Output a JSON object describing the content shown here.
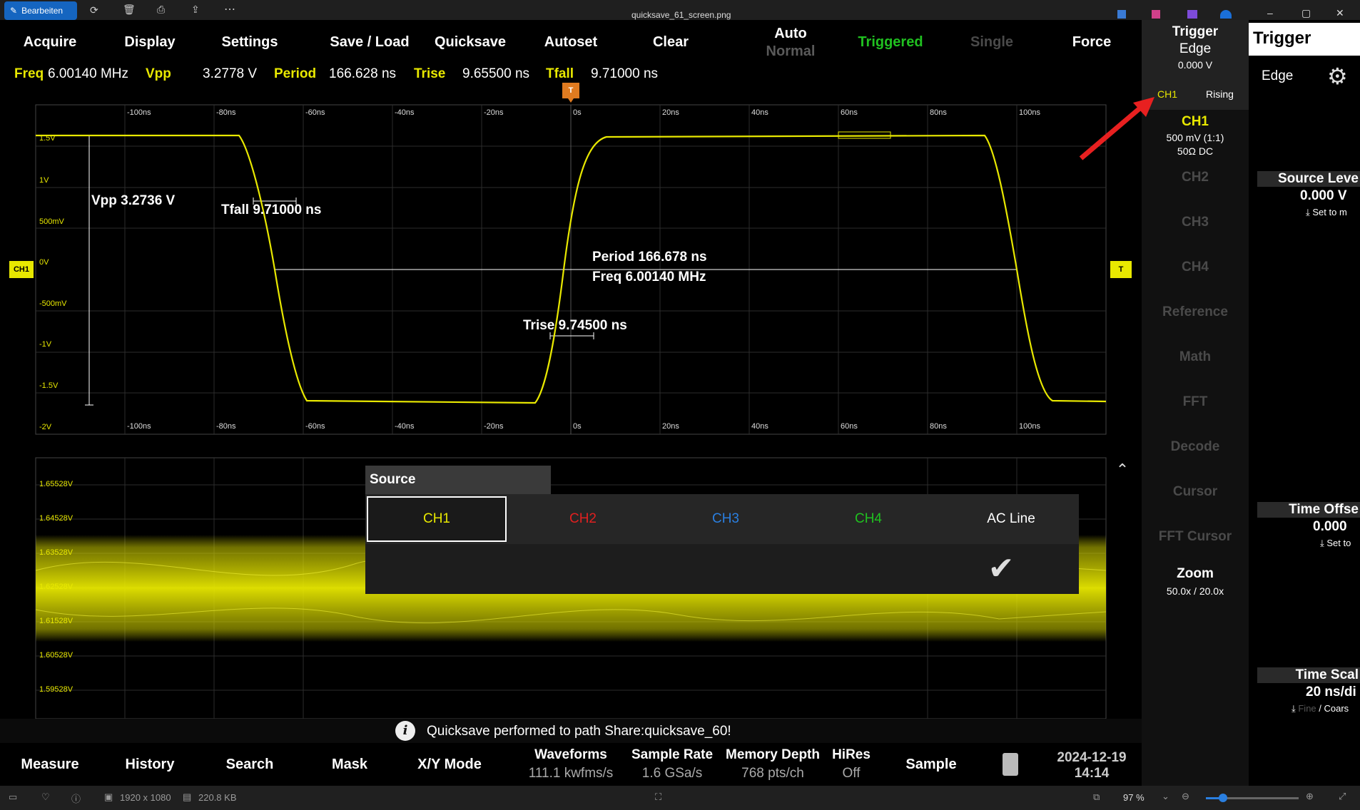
{
  "viewer": {
    "edit_label": "Bearbeiten",
    "filename": "quicksave_61_screen.png",
    "dimensions": "1920 x 1080",
    "filesize": "220.8 KB",
    "zoom": "97 %"
  },
  "menu": {
    "acquire": "Acquire",
    "display": "Display",
    "settings": "Settings",
    "save_load": "Save / Load",
    "quicksave": "Quicksave",
    "autoset": "Autoset",
    "clear": "Clear",
    "auto": "Auto",
    "normal": "Normal",
    "triggered": "Triggered",
    "single": "Single",
    "force": "Force"
  },
  "measurements": {
    "freq_label": "Freq",
    "freq_value": "6.00140 MHz",
    "vpp_label": "Vpp",
    "vpp_value": "3.2778 V",
    "period_label": "Period",
    "period_value": "166.628 ns",
    "trise_label": "Trise",
    "trise_value": "9.65500 ns",
    "tfall_label": "Tfall",
    "tfall_value": "9.71000 ns"
  },
  "scope": {
    "x_ticks": [
      "-100ns",
      "-80ns",
      "-60ns",
      "-40ns",
      "-20ns",
      "0s",
      "20ns",
      "40ns",
      "60ns",
      "80ns",
      "100ns"
    ],
    "y_ticks": [
      "1.5V",
      "1V",
      "500mV",
      "0V",
      "-500mV",
      "-1V",
      "-1.5V",
      "-2V"
    ],
    "ch1_marker": "CH1",
    "trigger_marker": "T",
    "vpp_annot": "Vpp 3.2736 V",
    "tfall_annot": "Tfall 9.71000 ns",
    "period_annot": "Period 166.678 ns",
    "freq_annot": "Freq 6.00140 MHz",
    "trise_annot": "Trise 9.74500 ns"
  },
  "zoom_view": {
    "y_ticks": [
      "1.65528V",
      "1.64528V",
      "1.63528V",
      "1.62528V",
      "1.61528V",
      "1.60528V",
      "1.59528V"
    ]
  },
  "source_popup": {
    "title": "Source",
    "options": [
      "CH1",
      "CH2",
      "CH3",
      "CH4",
      "AC Line"
    ],
    "selected": "CH1",
    "option_colors": [
      "#e8e800",
      "#e02020",
      "#2a7fe0",
      "#20c020",
      "#ffffff"
    ]
  },
  "sidebar": {
    "trigger_title": "Trigger",
    "trigger_type": "Edge",
    "trigger_level": "0.000 V",
    "trigger_source": "CH1",
    "trigger_slope": "Rising",
    "ch1_title": "CH1",
    "ch1_scale": "500 mV (1:1)",
    "ch1_coupling": "50Ω DC",
    "items": [
      "CH2",
      "CH3",
      "CH4",
      "Reference",
      "Math",
      "FFT",
      "Decode",
      "Cursor",
      "FFT Cursor"
    ],
    "zoom_title": "Zoom",
    "zoom_value": "50.0x / 20.0x"
  },
  "panel": {
    "title": "Trigger",
    "edge": "Edge",
    "source_level_title": "Source Leve",
    "source_level_value": "0.000 V",
    "source_level_action": "Set to m",
    "time_offset_title": "Time Offse",
    "time_offset_value": "0.000",
    "time_offset_action": "Set to",
    "time_scale_title": "Time Scal",
    "time_scale_value": "20 ns/di",
    "time_scale_fine": "Fine",
    "time_scale_coarse": "/ Coars"
  },
  "toast": {
    "message": "Quicksave performed to path Share:quicksave_60!"
  },
  "bottom": {
    "measure": "Measure",
    "history": "History",
    "search": "Search",
    "mask": "Mask",
    "xy_mode": "X/Y Mode",
    "waveforms_label": "Waveforms",
    "waveforms_value": "111.1 kwfms/s",
    "sample_rate_label": "Sample Rate",
    "sample_rate_value": "1.6 GSa/s",
    "memory_depth_label": "Memory Depth",
    "memory_depth_value": "768 pts/ch",
    "hires_label": "HiRes",
    "hires_value": "Off",
    "sample": "Sample",
    "date": "2024-12-19",
    "time": "14:14"
  },
  "colors": {
    "ch1": "#e8e800",
    "triggered": "#20c020",
    "accent_red": "#e02020"
  }
}
